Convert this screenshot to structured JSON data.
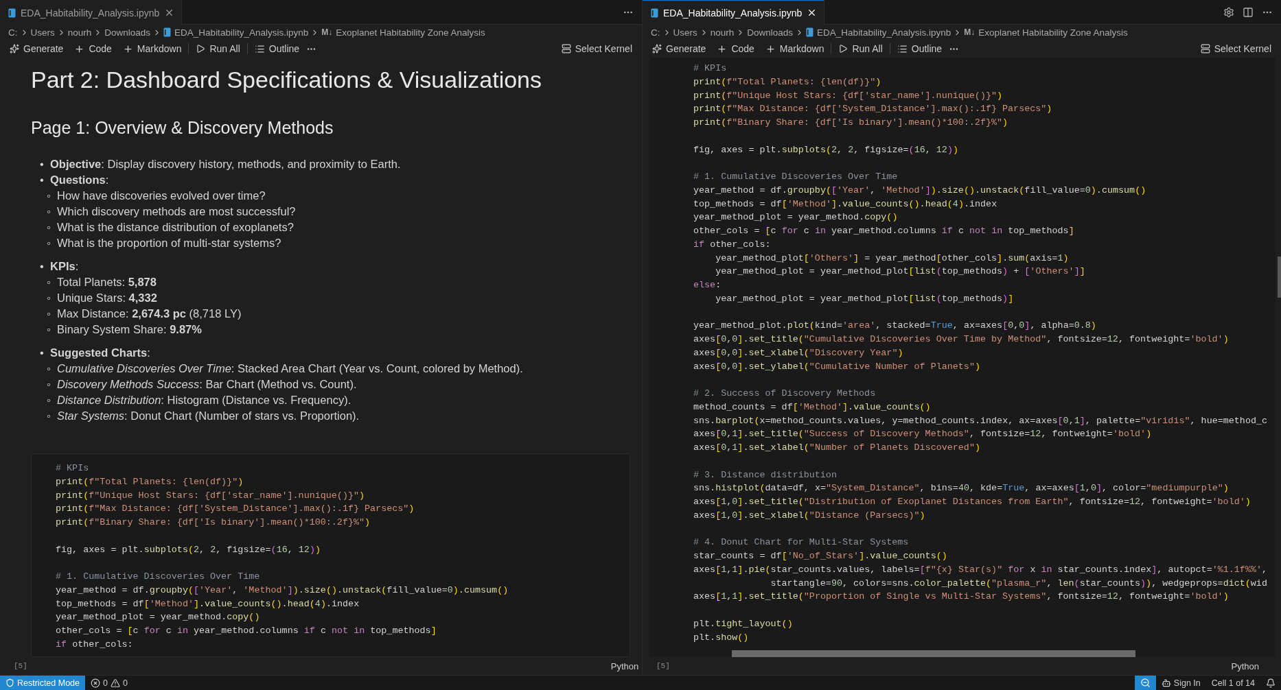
{
  "panes": [
    {
      "tab": {
        "label": "EDA_Habitability_Analysis.ipynb",
        "selected": false
      },
      "breadcrumb": [
        {
          "kind": "folder",
          "label": "C:"
        },
        {
          "kind": "folder",
          "label": "Users"
        },
        {
          "kind": "folder",
          "label": "nourh"
        },
        {
          "kind": "folder",
          "label": "Downloads"
        },
        {
          "kind": "notebook",
          "label": "EDA_Habitability_Analysis.ipynb"
        },
        {
          "kind": "markdown",
          "icon": "M↓",
          "label": "Exoplanet Habitability Zone Analysis"
        }
      ],
      "toolbar": [
        {
          "kind": "generate",
          "label": "Generate"
        },
        {
          "kind": "add",
          "label": "Code"
        },
        {
          "kind": "add",
          "label": "Markdown"
        },
        {
          "kind": "run",
          "label": "Run All"
        },
        {
          "kind": "outline",
          "label": "Outline"
        }
      ],
      "kernel": "Select Kernel",
      "markdown": {
        "h1": "Part 2: Dashboard Specifications & Visualizations",
        "h2": "Page 1: Overview & Discovery Methods",
        "items": [
          {
            "marker": "•",
            "text": "**Objective**: Display discovery history, methods, and proximity to Earth."
          },
          {
            "marker": "•",
            "text": "**Questions**:",
            "children": [
              {
                "marker": "◦",
                "text": "How have discoveries evolved over time?"
              },
              {
                "marker": "◦",
                "text": "Which discovery methods are most successful?"
              },
              {
                "marker": "◦",
                "text": "What is the distance distribution of exoplanets?"
              },
              {
                "marker": "◦",
                "text": "What is the proportion of multi-star systems?"
              }
            ]
          },
          {
            "marker": "•",
            "text": "**KPIs**:",
            "children": [
              {
                "marker": "◦",
                "text": "Total Planets: **5,878**"
              },
              {
                "marker": "◦",
                "text": "Unique Stars: **4,332**"
              },
              {
                "marker": "◦",
                "text": "Max Distance: **2,674.3 pc** (8,718 LY)"
              },
              {
                "marker": "◦",
                "text": "Binary System Share: **9.87%**"
              }
            ]
          },
          {
            "marker": "•",
            "text": "**Suggested Charts**:",
            "children": [
              {
                "marker": "◦",
                "text": "*Cumulative Discoveries Over Time*: Stacked Area Chart (Year vs. Count, colored by Method)."
              },
              {
                "marker": "◦",
                "text": "*Discovery Methods Success*: Bar Chart (Method vs. Count)."
              },
              {
                "marker": "◦",
                "text": "*Distance Distribution*: Histogram (Distance vs. Frequency)."
              },
              {
                "marker": "◦",
                "text": "*Star Systems*: Donut Chart (Number of stars vs. Proportion)."
              }
            ]
          }
        ]
      },
      "code": [
        [
          "# KPIs",
          "print(f\"Total Planets: {len(df)}\")",
          "print(f\"Unique Host Stars: {df['star_name'].nunique()}\")",
          "print(f\"Max Distance: {df['System_Distance'].max():.1f} Parsecs\")",
          "print(f\"Binary Share: {df['Is binary'].mean()*100:.2f}%\")"
        ],
        [
          "fig, axes = plt.subplots(2, 2, figsize=(16, 12))"
        ],
        [
          "# 1. Cumulative Discoveries Over Time",
          "year_method = df.groupby(['Year', 'Method']).size().unstack(fill_value=0).cumsum()",
          "top_methods = df['Method'].value_counts().head(4).index",
          "year_method_plot = year_method.copy()",
          "other_cols = [c for c in year_method.columns if c not in top_methods]",
          "if other_cols:"
        ]
      ],
      "execution_count": "[5]",
      "language": "Python"
    },
    {
      "tab": {
        "label": "EDA_Habitability_Analysis.ipynb",
        "selected": true
      },
      "breadcrumb": [
        {
          "kind": "folder",
          "label": "C:"
        },
        {
          "kind": "folder",
          "label": "Users"
        },
        {
          "kind": "folder",
          "label": "nourh"
        },
        {
          "kind": "folder",
          "label": "Downloads"
        },
        {
          "kind": "notebook",
          "label": "EDA_Habitability_Analysis.ipynb"
        },
        {
          "kind": "markdown",
          "icon": "M↓",
          "label": "Exoplanet Habitability Zone Analysis"
        }
      ],
      "toolbar": [
        {
          "kind": "generate",
          "label": "Generate"
        },
        {
          "kind": "add",
          "label": "Code"
        },
        {
          "kind": "add",
          "label": "Markdown"
        },
        {
          "kind": "run",
          "label": "Run All"
        },
        {
          "kind": "outline",
          "label": "Outline"
        }
      ],
      "kernel": "Select Kernel",
      "code": [
        [
          "# KPIs",
          "print(f\"Total Planets: {len(df)}\")",
          "print(f\"Unique Host Stars: {df['star_name'].nunique()}\")",
          "print(f\"Max Distance: {df['System_Distance'].max():.1f} Parsecs\")",
          "print(f\"Binary Share: {df['Is binary'].mean()*100:.2f}%\")"
        ],
        [
          "fig, axes = plt.subplots(2, 2, figsize=(16, 12))"
        ],
        [
          "# 1. Cumulative Discoveries Over Time",
          "year_method = df.groupby(['Year', 'Method']).size().unstack(fill_value=0).cumsum()",
          "top_methods = df['Method'].value_counts().head(4).index",
          "year_method_plot = year_method.copy()",
          "other_cols = [c for c in year_method.columns if c not in top_methods]",
          "if other_cols:",
          "    year_method_plot['Others'] = year_method[other_cols].sum(axis=1)",
          "    year_method_plot = year_method_plot[list(top_methods) + ['Others']]",
          "else:",
          "    year_method_plot = year_method_plot[list(top_methods)]"
        ],
        [
          "year_method_plot.plot(kind='area', stacked=True, ax=axes[0,0], alpha=0.8)",
          "axes[0,0].set_title(\"Cumulative Discoveries Over Time by Method\", fontsize=12, fontweight='bold')",
          "axes[0,0].set_xlabel(\"Discovery Year\")",
          "axes[0,0].set_ylabel(\"Cumulative Number of Planets\")"
        ],
        [
          "# 2. Success of Discovery Methods",
          "method_counts = df['Method'].value_counts()",
          "sns.barplot(x=method_counts.values, y=method_counts.index, ax=axes[0,1], palette=\"viridis\", hue=method_c",
          "axes[0,1].set_title(\"Success of Discovery Methods\", fontsize=12, fontweight='bold')",
          "axes[0,1].set_xlabel(\"Number of Planets Discovered\")"
        ],
        [
          "# 3. Distance distribution",
          "sns.histplot(data=df, x=\"System_Distance\", bins=40, kde=True, ax=axes[1,0], color=\"mediumpurple\")",
          "axes[1,0].set_title(\"Distribution of Exoplanet Distances from Earth\", fontsize=12, fontweight='bold')",
          "axes[1,0].set_xlabel(\"Distance (Parsecs)\")"
        ],
        [
          "# 4. Donut Chart for Multi-Star Systems",
          "star_counts = df['No_of_Stars'].value_counts()",
          "axes[1,1].pie(star_counts.values, labels=[f\"{x} Star(s)\" for x in star_counts.index], autopct='%1.1f%%',",
          "              startangle=90, colors=sns.color_palette(\"plasma_r\", len(star_counts)), wedgeprops=dict(wid",
          "axes[1,1].set_title(\"Proportion of Single vs Multi-Star Systems\", fontsize=12, fontweight='bold')"
        ],
        [
          "plt.tight_layout()",
          "plt.show()"
        ]
      ],
      "execution_count": "[5]",
      "language": "Python"
    }
  ],
  "status_bar": {
    "restricted": "Restricted Mode",
    "errors": "0",
    "warnings": "0",
    "sign_in": "Sign In",
    "cell": "Cell 1 of 14"
  }
}
